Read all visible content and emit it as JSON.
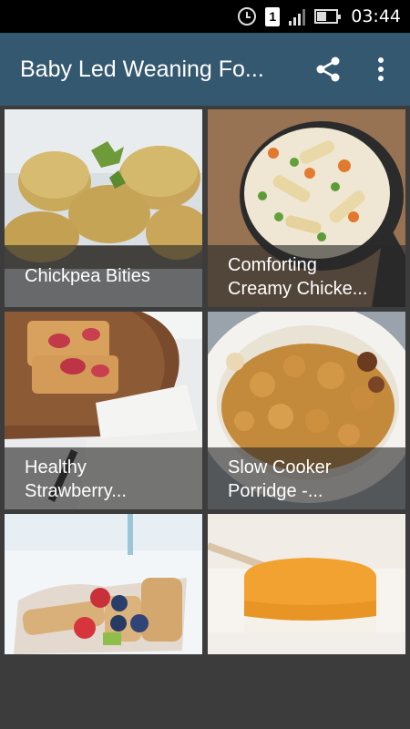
{
  "status_bar": {
    "time": "03:44",
    "sim_slot": "1",
    "icons": [
      "alarm-icon",
      "sim-1-icon",
      "signal-icon",
      "battery-icon"
    ]
  },
  "app_bar": {
    "title": "Baby Led Weaning Fo...",
    "actions": [
      "share-icon",
      "overflow-menu-icon"
    ],
    "color": "#34586f"
  },
  "recipes": [
    {
      "line1": "Chickpea Bities",
      "line2": ""
    },
    {
      "line1": "Comforting",
      "line2": "Creamy Chicke..."
    },
    {
      "line1": "Healthy",
      "line2": "Strawberry..."
    },
    {
      "line1": "Slow Cooker",
      "line2": "Porridge -..."
    },
    {
      "line1": "",
      "line2": ""
    },
    {
      "line1": "",
      "line2": ""
    }
  ]
}
